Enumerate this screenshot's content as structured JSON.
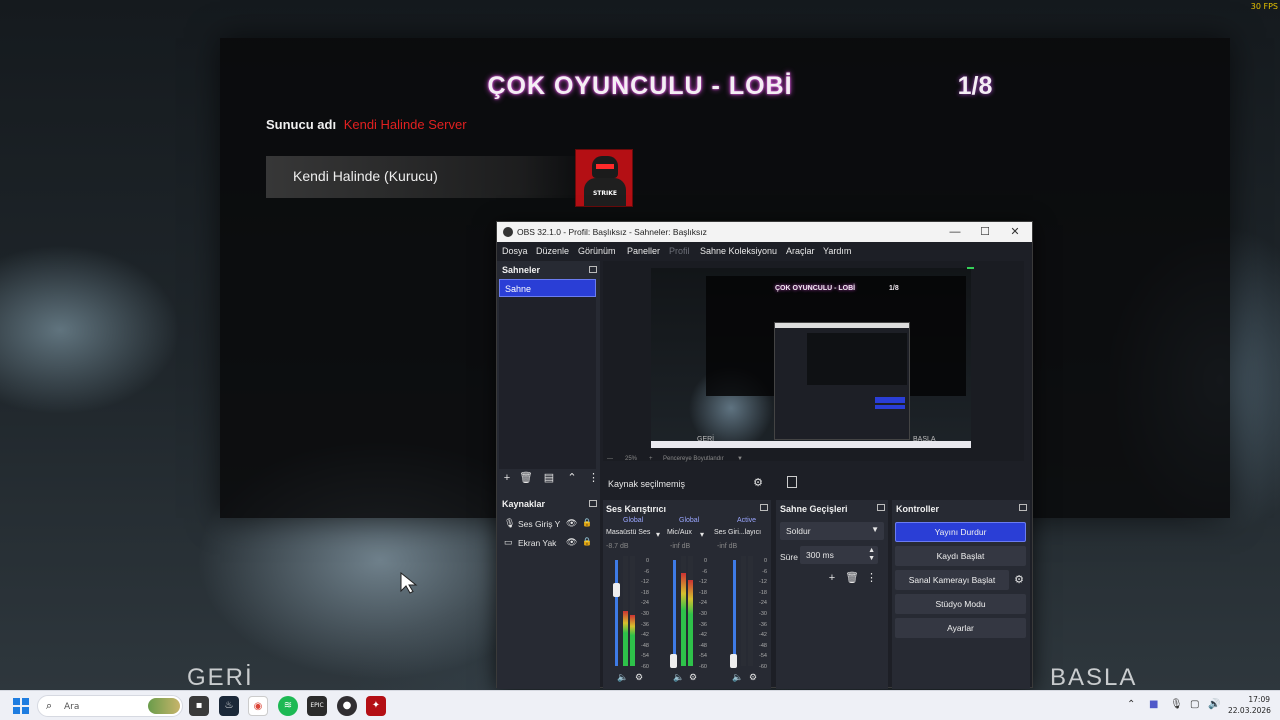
{
  "game": {
    "title": "ÇOK OYUNCULU - LOBİ",
    "player_count": "1/8",
    "server_label": "Sunucu adı",
    "server_name": "Kendi Halinde Server",
    "player_name": "Kendi Halinde (Kurucu)",
    "back_label": "GERİ",
    "start_label": "BASLA",
    "fps": "30 FPS"
  },
  "obs": {
    "title": "OBS 32.1.0 - Profil: Başlıksız - Sahneler: Başlıksız",
    "menu": [
      "Dosya",
      "Düzenle",
      "Görünüm",
      "Paneller",
      "Profil",
      "Sahne Koleksiyonu",
      "Araçlar",
      "Yardım"
    ],
    "scenes_title": "Sahneler",
    "scenes": [
      "Sahne"
    ],
    "sources_title": "Kaynaklar",
    "sources": [
      {
        "name": "Ses Giriş Y",
        "icon": "microphone-icon"
      },
      {
        "name": "Ekran Yak",
        "icon": "monitor-icon"
      }
    ],
    "no_source_label": "Kaynak seçilmemiş",
    "preview_status": {
      "zoom": "25%",
      "fit": "Pencereye Boyutlandır"
    },
    "mixer": {
      "title": "Ses Karıştırıcı",
      "channels": [
        {
          "tab": "Global",
          "name": "Masaüstü Ses",
          "db": "-8.7 dB",
          "level": 0.5,
          "fader": 0.72
        },
        {
          "tab": "Global",
          "name": "Mic/Aux",
          "db": "-inf dB",
          "level": 0.85,
          "fader": 0.05
        },
        {
          "tab": "Active",
          "name": "Ses Giri...layıcı",
          "db": "-inf dB",
          "level": 0.0,
          "fader": 0.05
        }
      ],
      "scale": [
        "0",
        "-6",
        "-12",
        "-18",
        "-24",
        "-30",
        "-36",
        "-42",
        "-48",
        "-54",
        "-60"
      ]
    },
    "transitions": {
      "title": "Sahne Geçişleri",
      "selected": "Soldur",
      "duration_label": "Süre",
      "duration": "300 ms"
    },
    "controls": {
      "title": "Kontroller",
      "buttons": [
        "Yayını Durdur",
        "Kaydı Başlat",
        "Sanal Kamerayı Başlat",
        "Stüdyo Modu",
        "Ayarlar"
      ]
    },
    "preview_thumb": {
      "title": "ÇOK OYUNCULU - LOBİ",
      "count": "1/8",
      "back": "GERİ",
      "start": "BASLA"
    }
  },
  "taskbar": {
    "search_placeholder": "Ara",
    "time": "17:09",
    "date": "22.03.2026"
  },
  "colors": {
    "accent": "#2a3ed6",
    "server_name": "#e02020",
    "title_glow": "#d24bd6"
  }
}
